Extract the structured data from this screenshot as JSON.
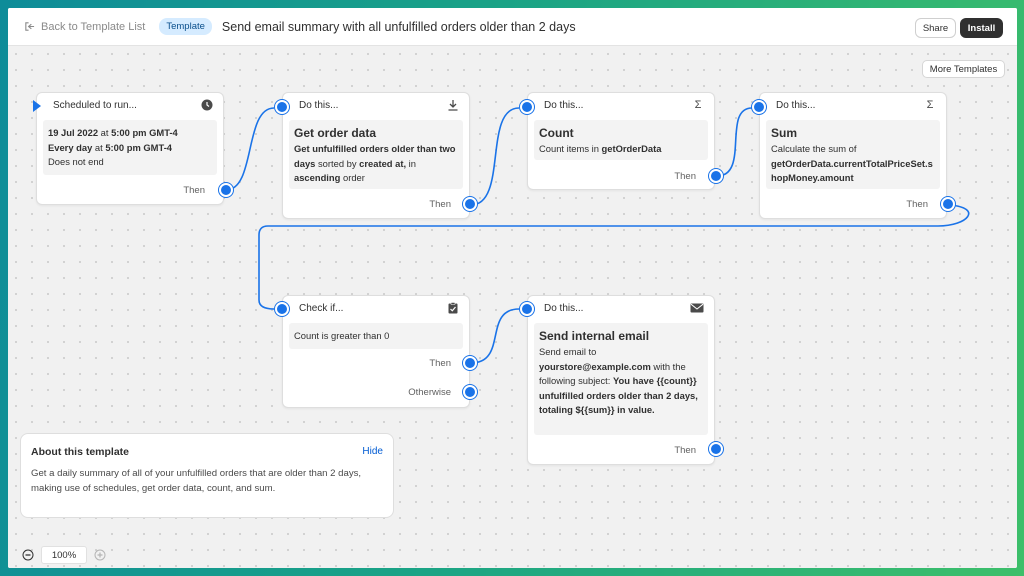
{
  "topbar": {
    "back_label": "Back to Template List",
    "badge": "Template",
    "title": "Send email summary with all unfulfilled orders older than 2 days",
    "share_label": "Share",
    "install_label": "Install"
  },
  "canvas": {
    "more_templates_label": "More Templates"
  },
  "nodes": {
    "trigger": {
      "header": "Scheduled to run...",
      "icon": "clock-icon",
      "date": "19 Jul 2022",
      "at1": " at ",
      "time1": "5:00 pm GMT-4",
      "every": "Every day",
      "at2": " at ",
      "time2": "5:00 pm GMT-4",
      "end": "Does not end",
      "then": "Then"
    },
    "get_order": {
      "header": "Do this...",
      "icon": "download-icon",
      "title": "Get order data",
      "desc_b1": "Get unfulfilled orders older than two days",
      "desc_t1": " sorted by ",
      "desc_b2": "created at,",
      "desc_t2": " in ",
      "desc_b3": "ascending",
      "desc_t3": " order",
      "then": "Then"
    },
    "count": {
      "header": "Do this...",
      "icon": "sigma-icon",
      "title": "Count",
      "desc_t1": "Count items in ",
      "desc_b1": "getOrderData",
      "then": "Then"
    },
    "sum": {
      "header": "Do this...",
      "icon": "sigma-icon",
      "title": "Sum",
      "desc_t1": "Calculate the sum of",
      "desc_b1": "getOrderData.currentTotalPriceSet.shopMoney.amount",
      "then": "Then"
    },
    "check": {
      "header": "Check if...",
      "icon": "clipboard-check-icon",
      "condition": "Count is greater than 0",
      "then": "Then",
      "otherwise": "Otherwise"
    },
    "email": {
      "header": "Do this...",
      "icon": "mail-icon",
      "title": "Send internal email",
      "desc_t1": "Send email to ",
      "desc_b1": "yourstore@example.com",
      "desc_t2": " with the following subject: ",
      "desc_b2": "You have {{count}} unfulfilled orders older than 2 days, totaling ${{sum}} in value.",
      "then": "Then"
    }
  },
  "about": {
    "title": "About this template",
    "hide_label": "Hide",
    "description": "Get a daily summary of all of your unfulfilled orders that are older than 2 days, making use of schedules, get order data, count, and sum."
  },
  "zoom": {
    "value": "100%"
  },
  "colors": {
    "accent": "#1a73e8",
    "install_bg": "#303030",
    "badge_bg": "#d5ebff"
  }
}
